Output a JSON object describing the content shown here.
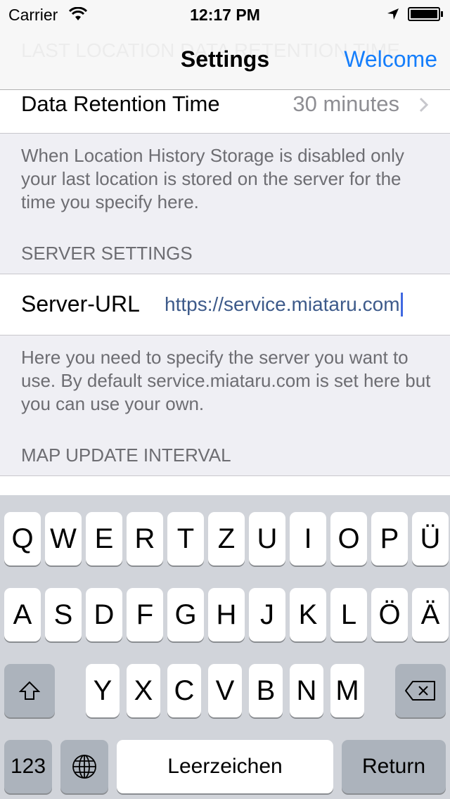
{
  "status_bar": {
    "carrier": "Carrier",
    "time": "12:17 PM"
  },
  "nav": {
    "title": "Settings",
    "right_button": "Welcome",
    "behind_text": "LAST LOCATION DATA RETENTION TIME"
  },
  "retention": {
    "label": "Data Retention Time",
    "value": "30 minutes",
    "footer": "When Location History Storage is disabled only your last location is stored on the server for the time you specify here."
  },
  "server": {
    "header": "SERVER SETTINGS",
    "label": "Server-URL",
    "value": "https://service.miataru.com",
    "footer": "Here you need to specify the server you want to use. By default service.miataru.com is set here but you can use your own."
  },
  "map": {
    "header": "MAP UPDATE INTERVAL"
  },
  "keyboard": {
    "row1": [
      "Q",
      "W",
      "E",
      "R",
      "T",
      "Z",
      "U",
      "I",
      "O",
      "P",
      "Ü"
    ],
    "row2": [
      "A",
      "S",
      "D",
      "F",
      "G",
      "H",
      "J",
      "K",
      "L",
      "Ö",
      "Ä"
    ],
    "row3": [
      "Y",
      "X",
      "C",
      "V",
      "B",
      "N",
      "M"
    ],
    "numbers": "123",
    "space": "Leerzeichen",
    "return": "Return"
  },
  "colors": {
    "accent": "#157efb",
    "url_text": "#3d5a8a",
    "cursor": "#4169e1"
  }
}
